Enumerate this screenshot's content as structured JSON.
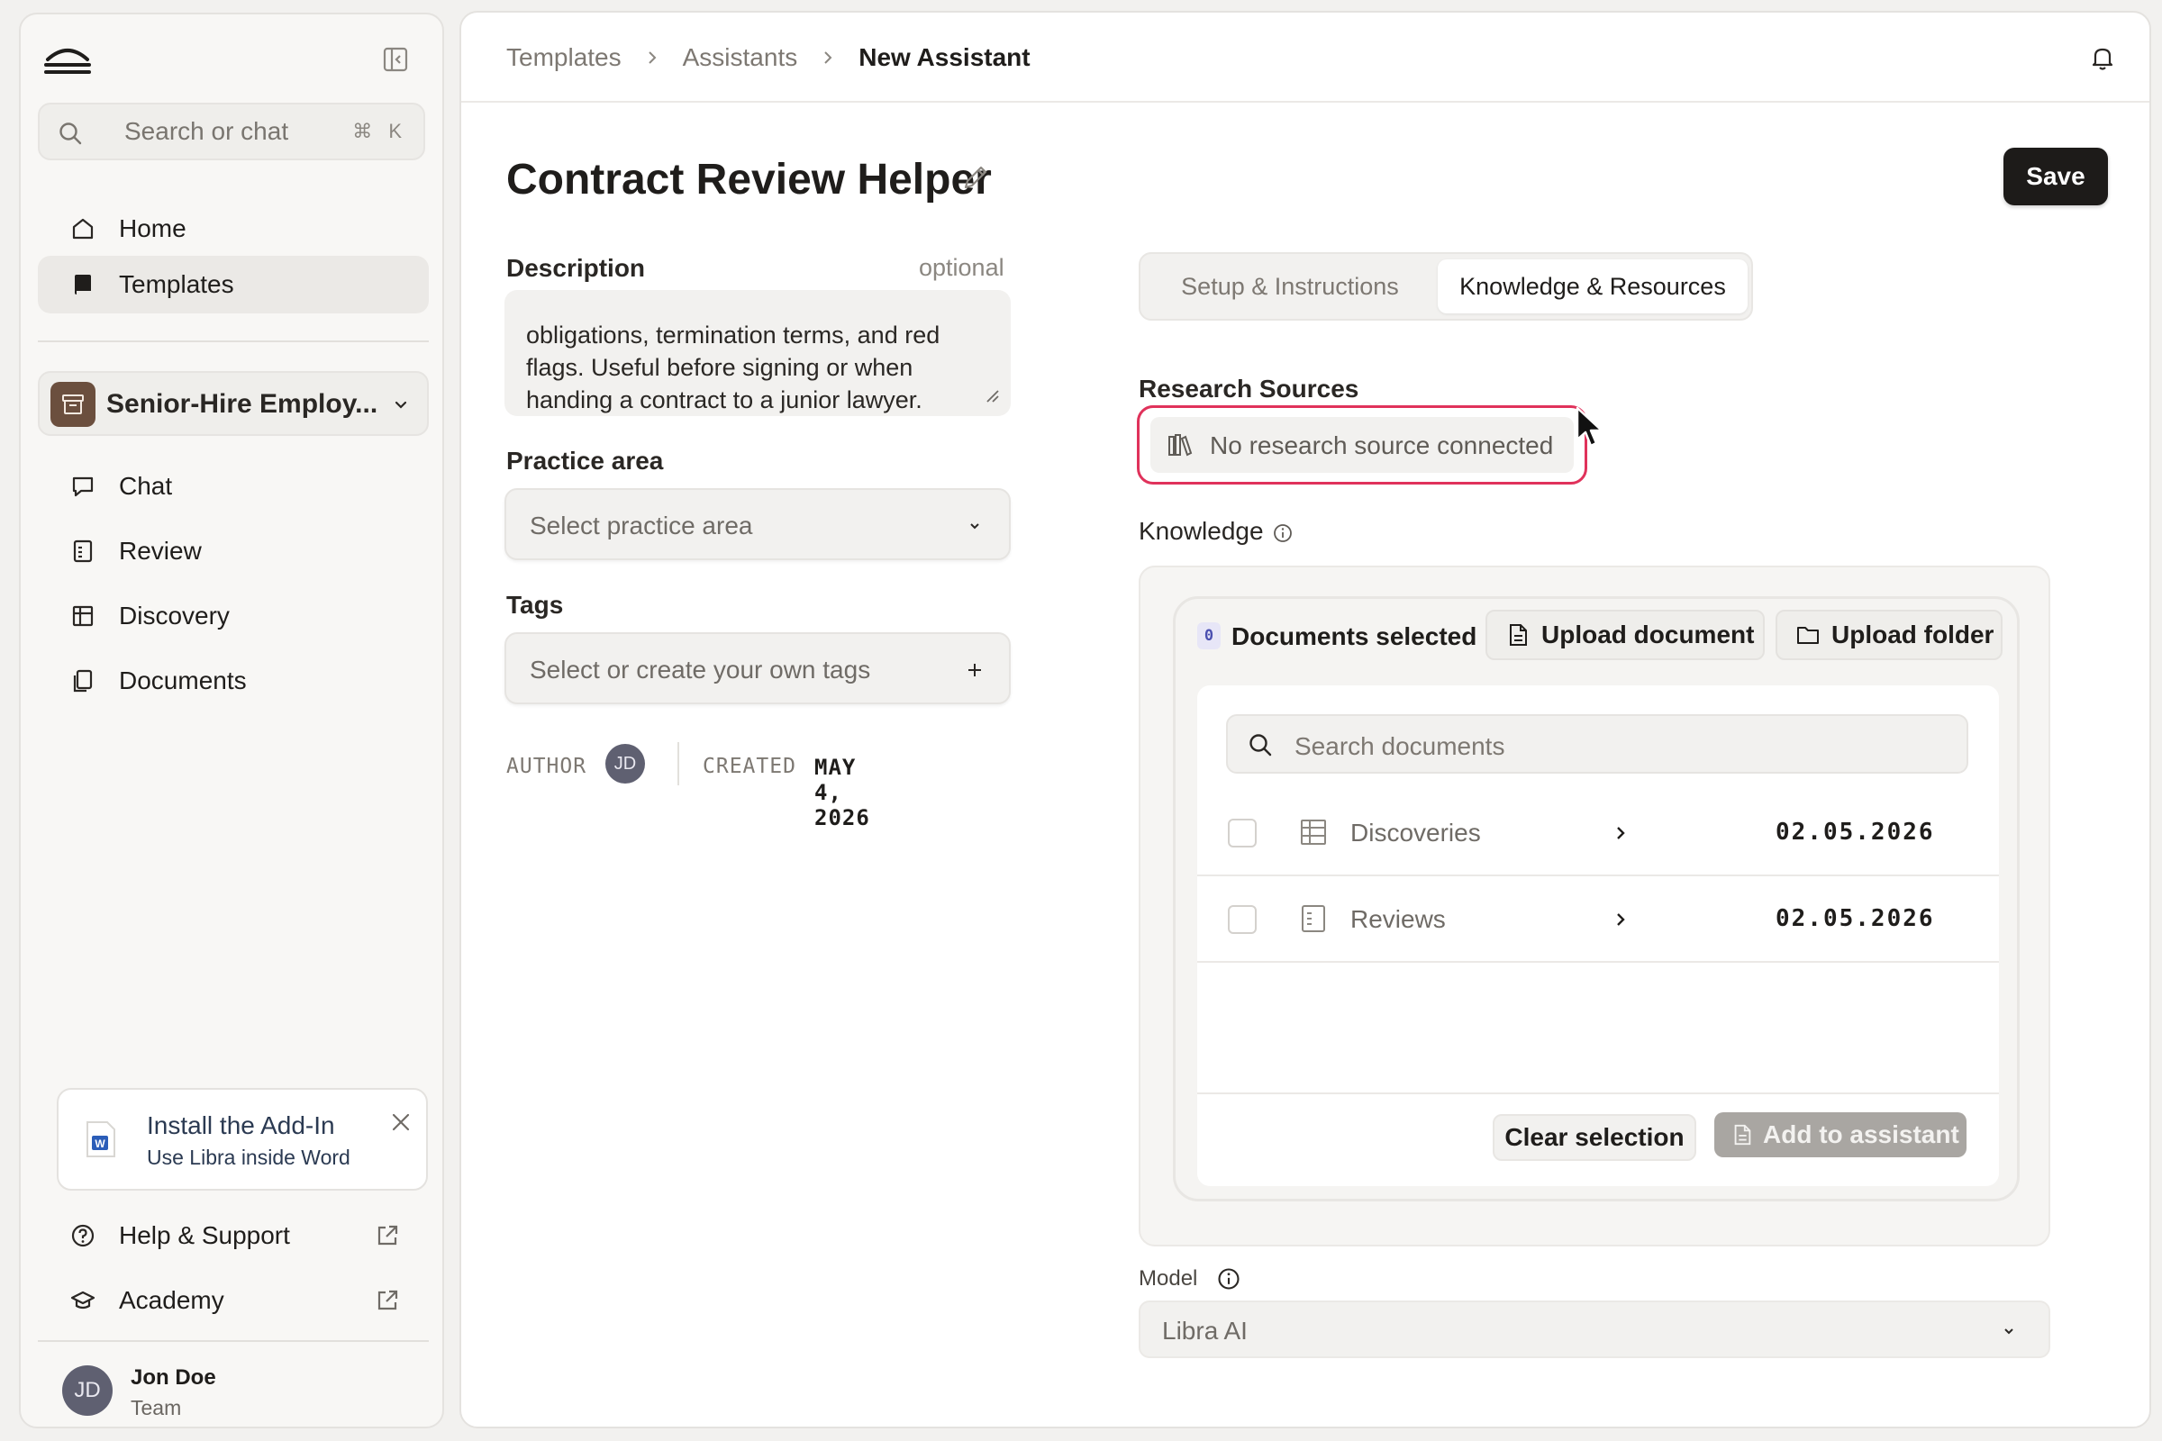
{
  "sidebar": {
    "search": {
      "placeholder": "Search or chat",
      "shortcut": "⌘ K"
    },
    "nav": [
      {
        "label": "Home",
        "icon": "home-icon"
      },
      {
        "label": "Templates",
        "icon": "book-icon",
        "active": true
      }
    ],
    "workspace": {
      "label": "Senior-Hire Employ..."
    },
    "workspace_nav": [
      {
        "label": "Chat",
        "icon": "chat-icon"
      },
      {
        "label": "Review",
        "icon": "review-icon"
      },
      {
        "label": "Discovery",
        "icon": "table-icon"
      },
      {
        "label": "Documents",
        "icon": "documents-icon"
      }
    ],
    "addin": {
      "title": "Install the Add-In",
      "subtitle": "Use Libra inside Word"
    },
    "footer_links": [
      {
        "label": "Help & Support",
        "icon": "help-icon"
      },
      {
        "label": "Academy",
        "icon": "graduation-cap-icon"
      }
    ],
    "user": {
      "initials": "JD",
      "name": "Jon Doe",
      "role": "Team"
    }
  },
  "header": {
    "breadcrumbs": [
      "Templates",
      "Assistants",
      "New Assistant"
    ]
  },
  "page": {
    "title": "Contract Review Helper",
    "save_label": "Save",
    "description": {
      "label": "Description",
      "optional": "optional",
      "value": "obligations, termination terms, and red flags. Useful before signing or when handing a contract to a junior lawyer."
    },
    "practice_area": {
      "label": "Practice area",
      "placeholder": "Select practice area"
    },
    "tags": {
      "label": "Tags",
      "placeholder": "Select or create your own tags"
    },
    "meta": {
      "author_label": "AUTHOR",
      "author_initials": "JD",
      "created_label": "CREATED",
      "created_value": "MAY 4, 2026"
    }
  },
  "tabs": [
    {
      "label": "Setup & Instructions",
      "active": false
    },
    {
      "label": "Knowledge & Resources",
      "active": true
    }
  ],
  "research": {
    "label": "Research Sources",
    "empty": "No research source connected"
  },
  "knowledge": {
    "label": "Knowledge",
    "selected_count": "0",
    "selected_label": "Documents selected",
    "upload_document": "Upload document",
    "upload_folder": "Upload folder",
    "search_placeholder": "Search documents",
    "rows": [
      {
        "name": "Discoveries",
        "date": "02.05.2026",
        "icon": "table-icon"
      },
      {
        "name": "Reviews",
        "date": "02.05.2026",
        "icon": "review-icon"
      }
    ],
    "clear_selection": "Clear selection",
    "add_to_assistant": "Add to assistant"
  },
  "model": {
    "label": "Model",
    "value": "Libra AI"
  },
  "colors": {
    "accent_dark": "#1d1b19",
    "highlight": "#e0325b",
    "avatar": "#5f6071",
    "workspace_badge": "#6b4f3e",
    "word_blue": "#2b5db8"
  }
}
